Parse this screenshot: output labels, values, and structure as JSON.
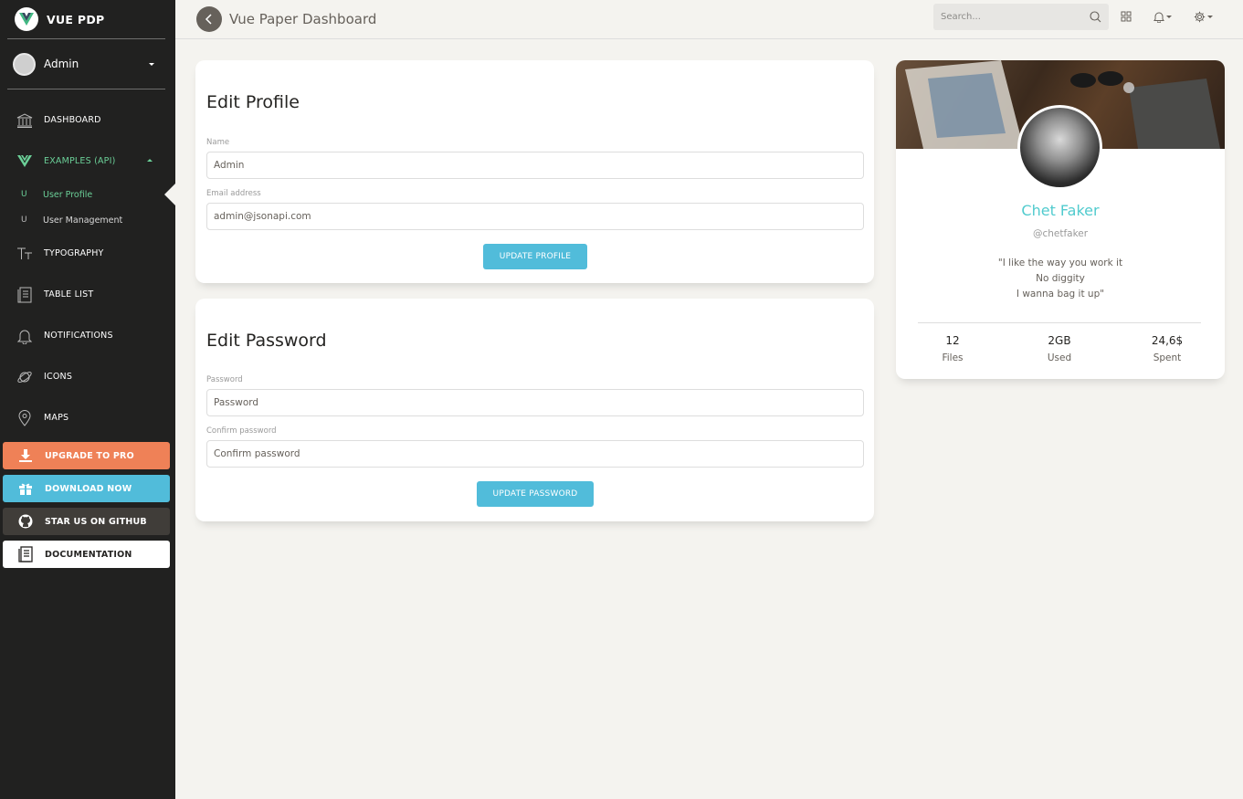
{
  "brand": {
    "name": "VUE PDP"
  },
  "user": {
    "name": "Admin"
  },
  "nav": {
    "dashboard": "DASHBOARD",
    "examples": "EXAMPLES (API)",
    "sub": [
      {
        "mini": "U",
        "label": "User Profile"
      },
      {
        "mini": "U",
        "label": "User Management"
      }
    ],
    "typography": "TYPOGRAPHY",
    "table_list": "TABLE LIST",
    "notifications": "NOTIFICATIONS",
    "icons": "ICONS",
    "maps": "MAPS"
  },
  "actions": {
    "upgrade": "UPGRADE TO PRO",
    "download": "DOWNLOAD NOW",
    "github": "STAR US ON GITHUB",
    "docs": "DOCUMENTATION"
  },
  "topbar": {
    "title": "Vue Paper Dashboard",
    "search_placeholder": "Search..."
  },
  "edit_profile": {
    "title": "Edit Profile",
    "name_label": "Name",
    "name_value": "Admin",
    "email_label": "Email address",
    "email_value": "admin@jsonapi.com",
    "button": "UPDATE PROFILE"
  },
  "edit_password": {
    "title": "Edit Password",
    "password_label": "Password",
    "password_placeholder": "Password",
    "confirm_label": "Confirm password",
    "confirm_placeholder": "Confirm password",
    "button": "UPDATE PASSWORD"
  },
  "profile": {
    "name": "Chet Faker",
    "handle": "@chetfaker",
    "quote": [
      "\"I like the way you work it",
      "No diggity",
      "I wanna bag it up\""
    ],
    "stats": [
      {
        "value": "12",
        "label": "Files"
      },
      {
        "value": "2GB",
        "label": "Used"
      },
      {
        "value": "24,6$",
        "label": "Spent"
      }
    ]
  },
  "colors": {
    "sidebar": "#212120",
    "active": "#6bd098",
    "info": "#51bcda",
    "warning": "#ef8157",
    "primary": "#51cbce"
  }
}
